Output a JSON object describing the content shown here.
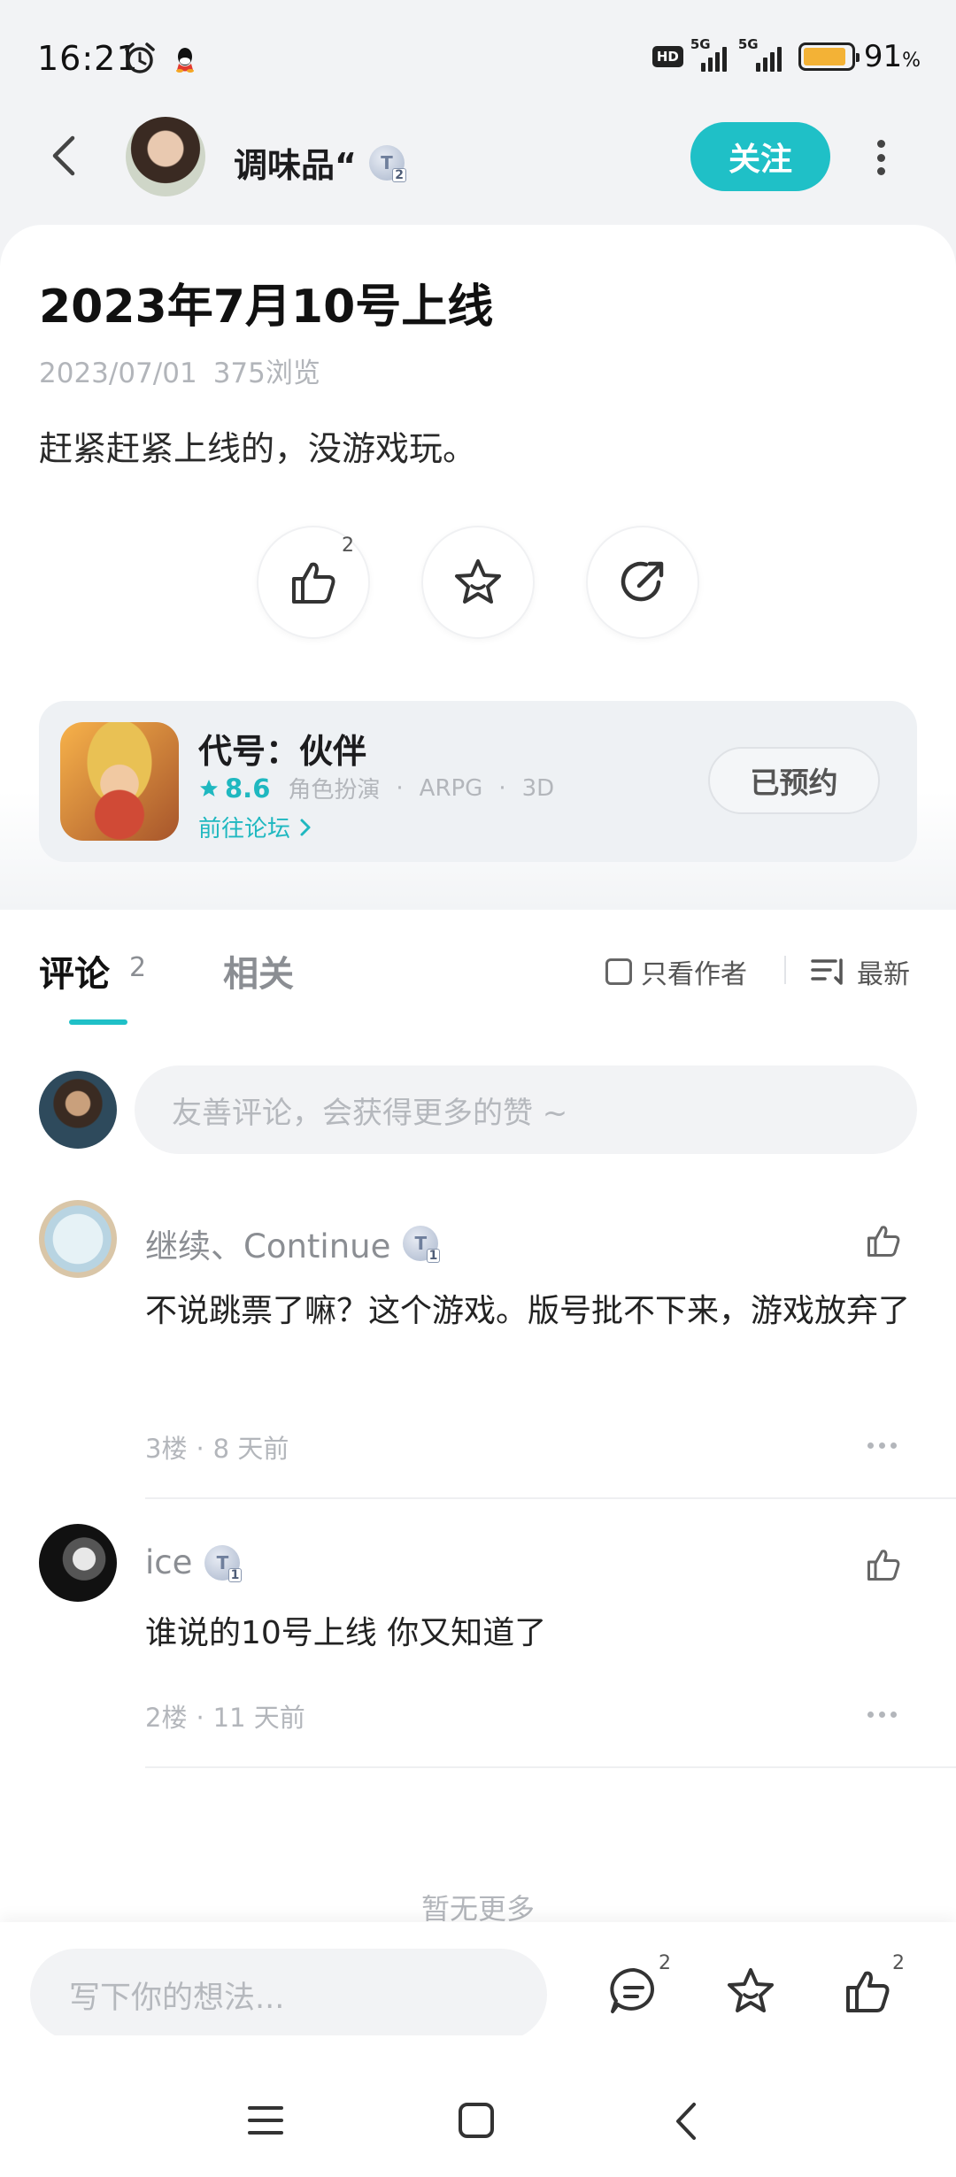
{
  "status_bar": {
    "time": "16:21",
    "network_badge": "HD",
    "sim1_label": "5G",
    "sim2_label": "5G",
    "battery_percent": "91",
    "battery_unit": "%",
    "battery_level": 0.91
  },
  "header": {
    "author_name": "调味品“",
    "author_level": "T",
    "author_level_sub": "2",
    "follow_label": "关注"
  },
  "post": {
    "title": "2023年7月10号上线",
    "date": "2023/07/01",
    "views": "375浏览",
    "body": "赶紧赶紧上线的，没游戏玩。",
    "like_count": "2"
  },
  "game": {
    "name": "代号：伙伴",
    "score": "8.6",
    "genre": "角色扮演",
    "tag1": "ARPG",
    "tag2": "3D",
    "forum_link": "前往论坛",
    "reserved_label": "已预约"
  },
  "tabs": {
    "comments_label": "评论",
    "comments_count": "2",
    "related_label": "相关",
    "only_author_label": "只看作者",
    "sort_label": "最新"
  },
  "comment_input_placeholder": "友善评论，会获得更多的赞 ~",
  "comments": [
    {
      "name": "继续、Continue",
      "level": "T",
      "level_sub": "1",
      "text": "不说跳票了嘛？这个游戏。版号批不下来，游戏放弃了",
      "floor": "3楼",
      "time": "8 天前"
    },
    {
      "name": "ice",
      "level": "T",
      "level_sub": "1",
      "text": "谁说的10号上线 你又知道了",
      "floor": "2楼",
      "time": "11 天前"
    }
  ],
  "no_more": "暂无更多",
  "bottom_bar": {
    "placeholder": "写下你的想法...",
    "comment_count": "2",
    "like_count": "2"
  },
  "colors": {
    "accent": "#1fc0c7",
    "battery": "#f3b236"
  }
}
